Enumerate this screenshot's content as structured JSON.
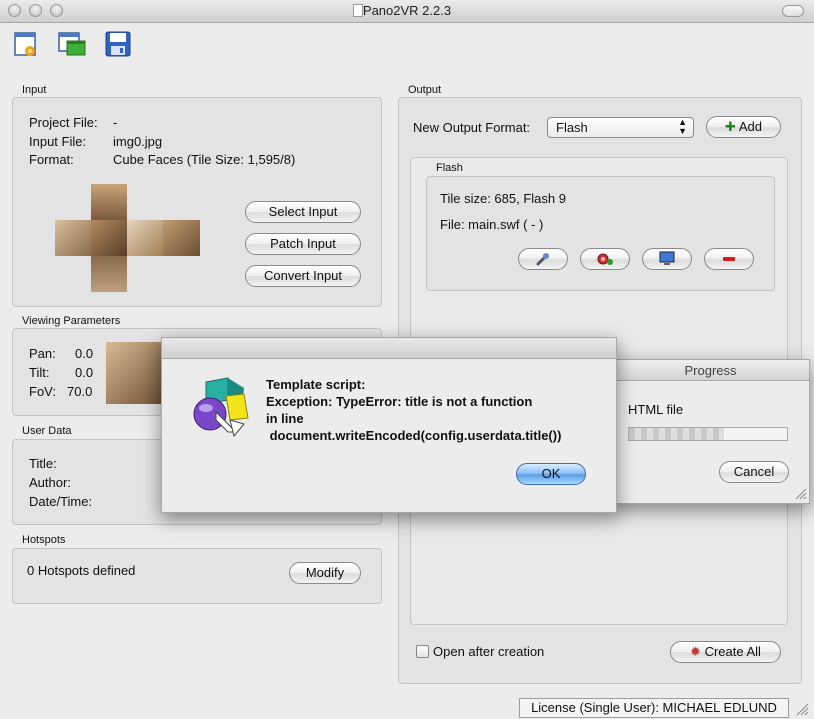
{
  "window": {
    "title": "Pano2VR 2.2.3"
  },
  "input": {
    "section_label": "Input",
    "project_file_label": "Project File:",
    "project_file_value": "-",
    "input_file_label": "Input File:",
    "input_file_value": "img0.jpg",
    "format_label": "Format:",
    "format_value": "Cube Faces (Tile Size: 1,595/8)",
    "select_input": "Select Input",
    "patch_input": "Patch Input",
    "convert_input": "Convert Input"
  },
  "viewing": {
    "section_label": "Viewing Parameters",
    "pan_label": "Pan:",
    "pan_value": "0.0",
    "tilt_label": "Tilt:",
    "tilt_value": "0.0",
    "fov_label": "FoV:",
    "fov_value": "70.0"
  },
  "user_data": {
    "section_label": "User Data",
    "title_label": "Title:",
    "author_label": "Author:",
    "datetime_label": "Date/Time:"
  },
  "hotspots": {
    "section_label": "Hotspots",
    "count_text": "0 Hotspots defined",
    "modify": "Modify"
  },
  "output": {
    "section_label": "Output",
    "new_format_label": "New Output Format:",
    "format_selected": "Flash",
    "add": "Add",
    "flash_label": "Flash",
    "tile_size": "Tile size: 685, Flash 9",
    "file": "File: main.swf ( - )",
    "open_after": "Open after creation",
    "create_all": "Create All"
  },
  "progress": {
    "title": "Progress",
    "file_label": "HTML file",
    "cancel": "Cancel",
    "fraction": 0.6
  },
  "alert": {
    "line1": "Template script:",
    "line2": "Exception: TypeError: title is not a function",
    "line3": "in line",
    "line4": " document.writeEncoded(config.userdata.title())",
    "ok": "OK"
  },
  "license": "License (Single User): MICHAEL EDLUND",
  "icons": {
    "toolbar": [
      "new-project-icon",
      "open-project-icon",
      "save-icon"
    ],
    "flash_actions": [
      "wrench-icon",
      "gear-icon",
      "monitor-icon",
      "remove-icon"
    ]
  }
}
